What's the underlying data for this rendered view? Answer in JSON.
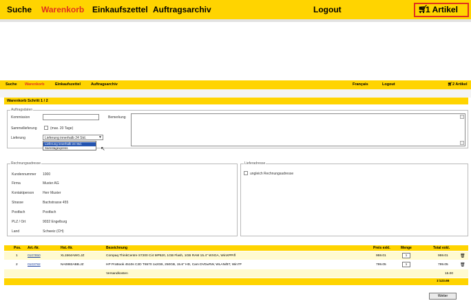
{
  "header": {
    "nav": [
      "Suche",
      "Warenkorb",
      "Einkaufszettel",
      "Auftragsarchiv"
    ],
    "logout": "Logout",
    "cart_label": "1 Artikel"
  },
  "small": {
    "nav": [
      "Suche",
      "Warenkorb",
      "Einkaufszettel",
      "Auftragsarchiv"
    ],
    "lang": "Français",
    "logout": "Logout",
    "cart_label": "2 Artikel",
    "title": "Warenkorb Schritt 1 / 2",
    "order": {
      "legend": "Auftragsdaten",
      "kommission_label": "Kommission",
      "bemerkung_label": "Bemerkung",
      "sammel_label": "Sammellieferung",
      "sammel_note": "(max. 20 Tage)",
      "lieferung_label": "Lieferung",
      "lieferung_value": "Lieferung innerhalb 24 Std.",
      "options": [
        "Lieferung innerhalb 24 Std.",
        "Samstagexpress"
      ]
    },
    "billing": {
      "legend": "Rechnungsadresse",
      "rows": [
        {
          "label": "Kundennummer",
          "value": "1000"
        },
        {
          "label": "Firma",
          "value": "Muster AG"
        },
        {
          "label": "Kontaktperson",
          "value": "Herr Muster"
        },
        {
          "label": "Strasse",
          "value": "Bachstrasse 455"
        },
        {
          "label": "Postfach",
          "value": "Postfach"
        },
        {
          "label": "PLZ / Ort",
          "value": "9032 Engelburg"
        },
        {
          "label": "Land",
          "value": "Schweiz (CH)"
        }
      ]
    },
    "delivery": {
      "legend": "Lieferadresse",
      "checkbox_label": "ungleich Rechnungsadresse"
    },
    "table": {
      "headers": [
        "Pos.",
        "Art.-Nr.",
        "Hst.-Nr.",
        "Bezeichnung",
        "Preis exkl.",
        "Menge",
        "Total exkl."
      ],
      "rows": [
        {
          "pos": "1",
          "art": "0107850",
          "hst": "XL1564AWG.JZ",
          "desc": "Compaq ThinkCentre S7200 Ci4 MP520, 1GB Flash, 1GB RAM 15.4\" WXGA, WinXPPrfl",
          "price": "959.01",
          "qty": "1",
          "total": "959.01"
        },
        {
          "pos": "2",
          "art": "0103782",
          "hst": "NA0882ABB.JZ",
          "desc": "HP ProBook 4510s C2D T6570 1x2GB, 250GB, 15.6\" HD, Cam DVD±RW, WLAN/BT, Win7P",
          "price": "799.05",
          "qty": "1",
          "total": "799.05"
        },
        {
          "pos": "",
          "art": "",
          "hst": "",
          "desc": "Versandkosten",
          "price": "",
          "qty": "",
          "total": "15.00"
        }
      ],
      "grand_total": "1'123.66"
    },
    "next_button": "Weiter"
  }
}
